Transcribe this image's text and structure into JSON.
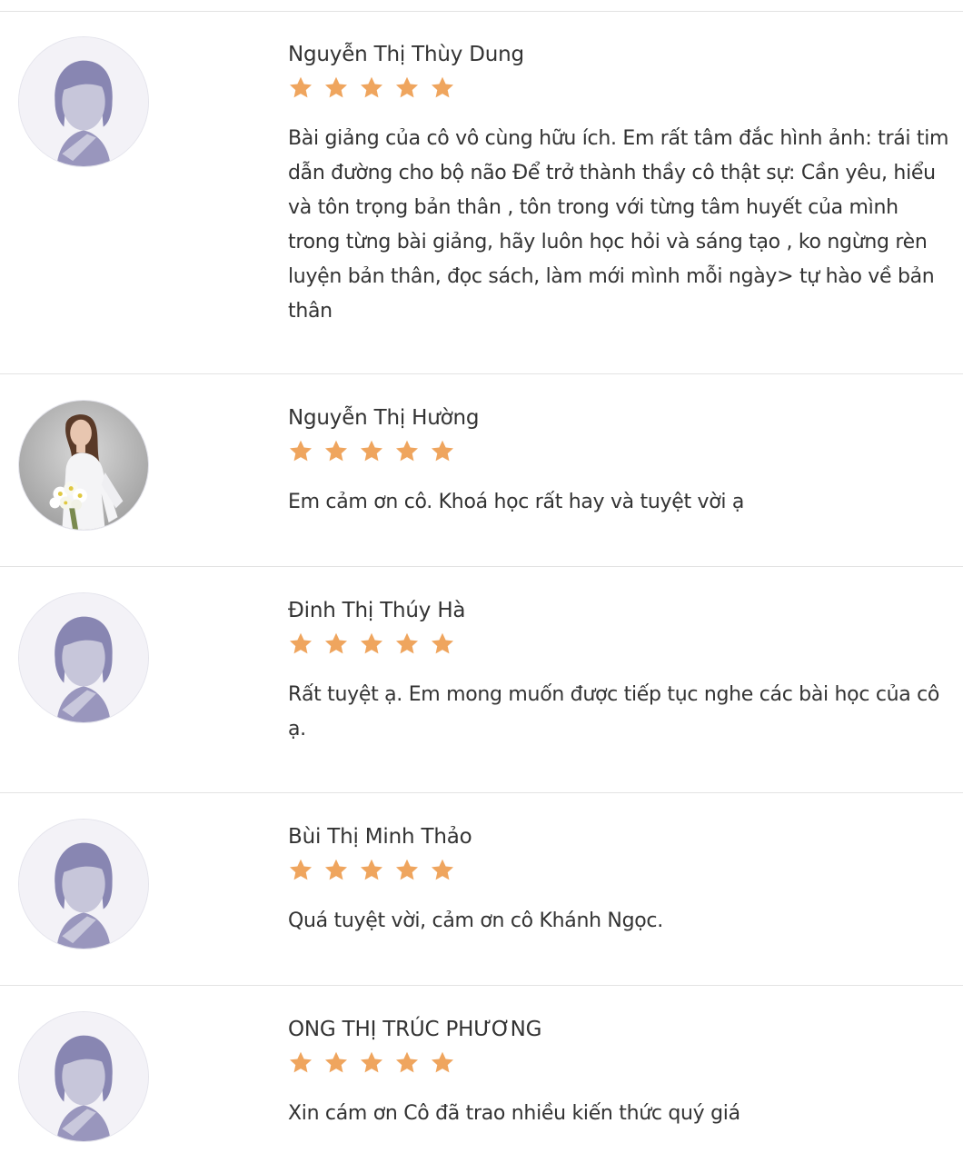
{
  "star_color": "#efa55e",
  "reviews": [
    {
      "name": "Nguyễn Thị Thùy Dung",
      "avatar": "default-avatar-icon",
      "rating": 5,
      "comment": "Bài giảng của cô vô cùng hữu ích. Em rất tâm đắc hình ảnh: trái tim dẫn đường cho bộ não Để trở thành thầy cô thật sự: Cần yêu, hiểu và tôn trọng bản thân , tôn trong với từng tâm huyết của mình trong từng bài giảng, hãy luôn học hỏi và sáng tạo , ko ngừng rèn luyện bản thân, đọc sách, làm mới mình mỗi ngày> tự hào về bản thân"
    },
    {
      "name": "Nguyễn Thị Hường",
      "avatar": "user-photo",
      "rating": 5,
      "comment": "Em cảm ơn cô. Khoá học rất hay và tuyệt vời ạ"
    },
    {
      "name": "Đinh Thị Thúy Hà",
      "avatar": "default-avatar-icon",
      "rating": 5,
      "comment": "Rất tuyệt ạ. Em mong muốn được tiếp tục nghe các bài học của cô ạ."
    },
    {
      "name": "Bùi Thị Minh Thảo",
      "avatar": "default-avatar-icon",
      "rating": 5,
      "comment": "Quá tuyệt vời, cảm ơn cô Khánh Ngọc."
    },
    {
      "name": "ONG THỊ TRÚC PHƯƠNG",
      "avatar": "default-avatar-icon",
      "rating": 5,
      "comment": "Xin cám ơn Cô đã trao nhiều kiến thức quý giá"
    }
  ]
}
